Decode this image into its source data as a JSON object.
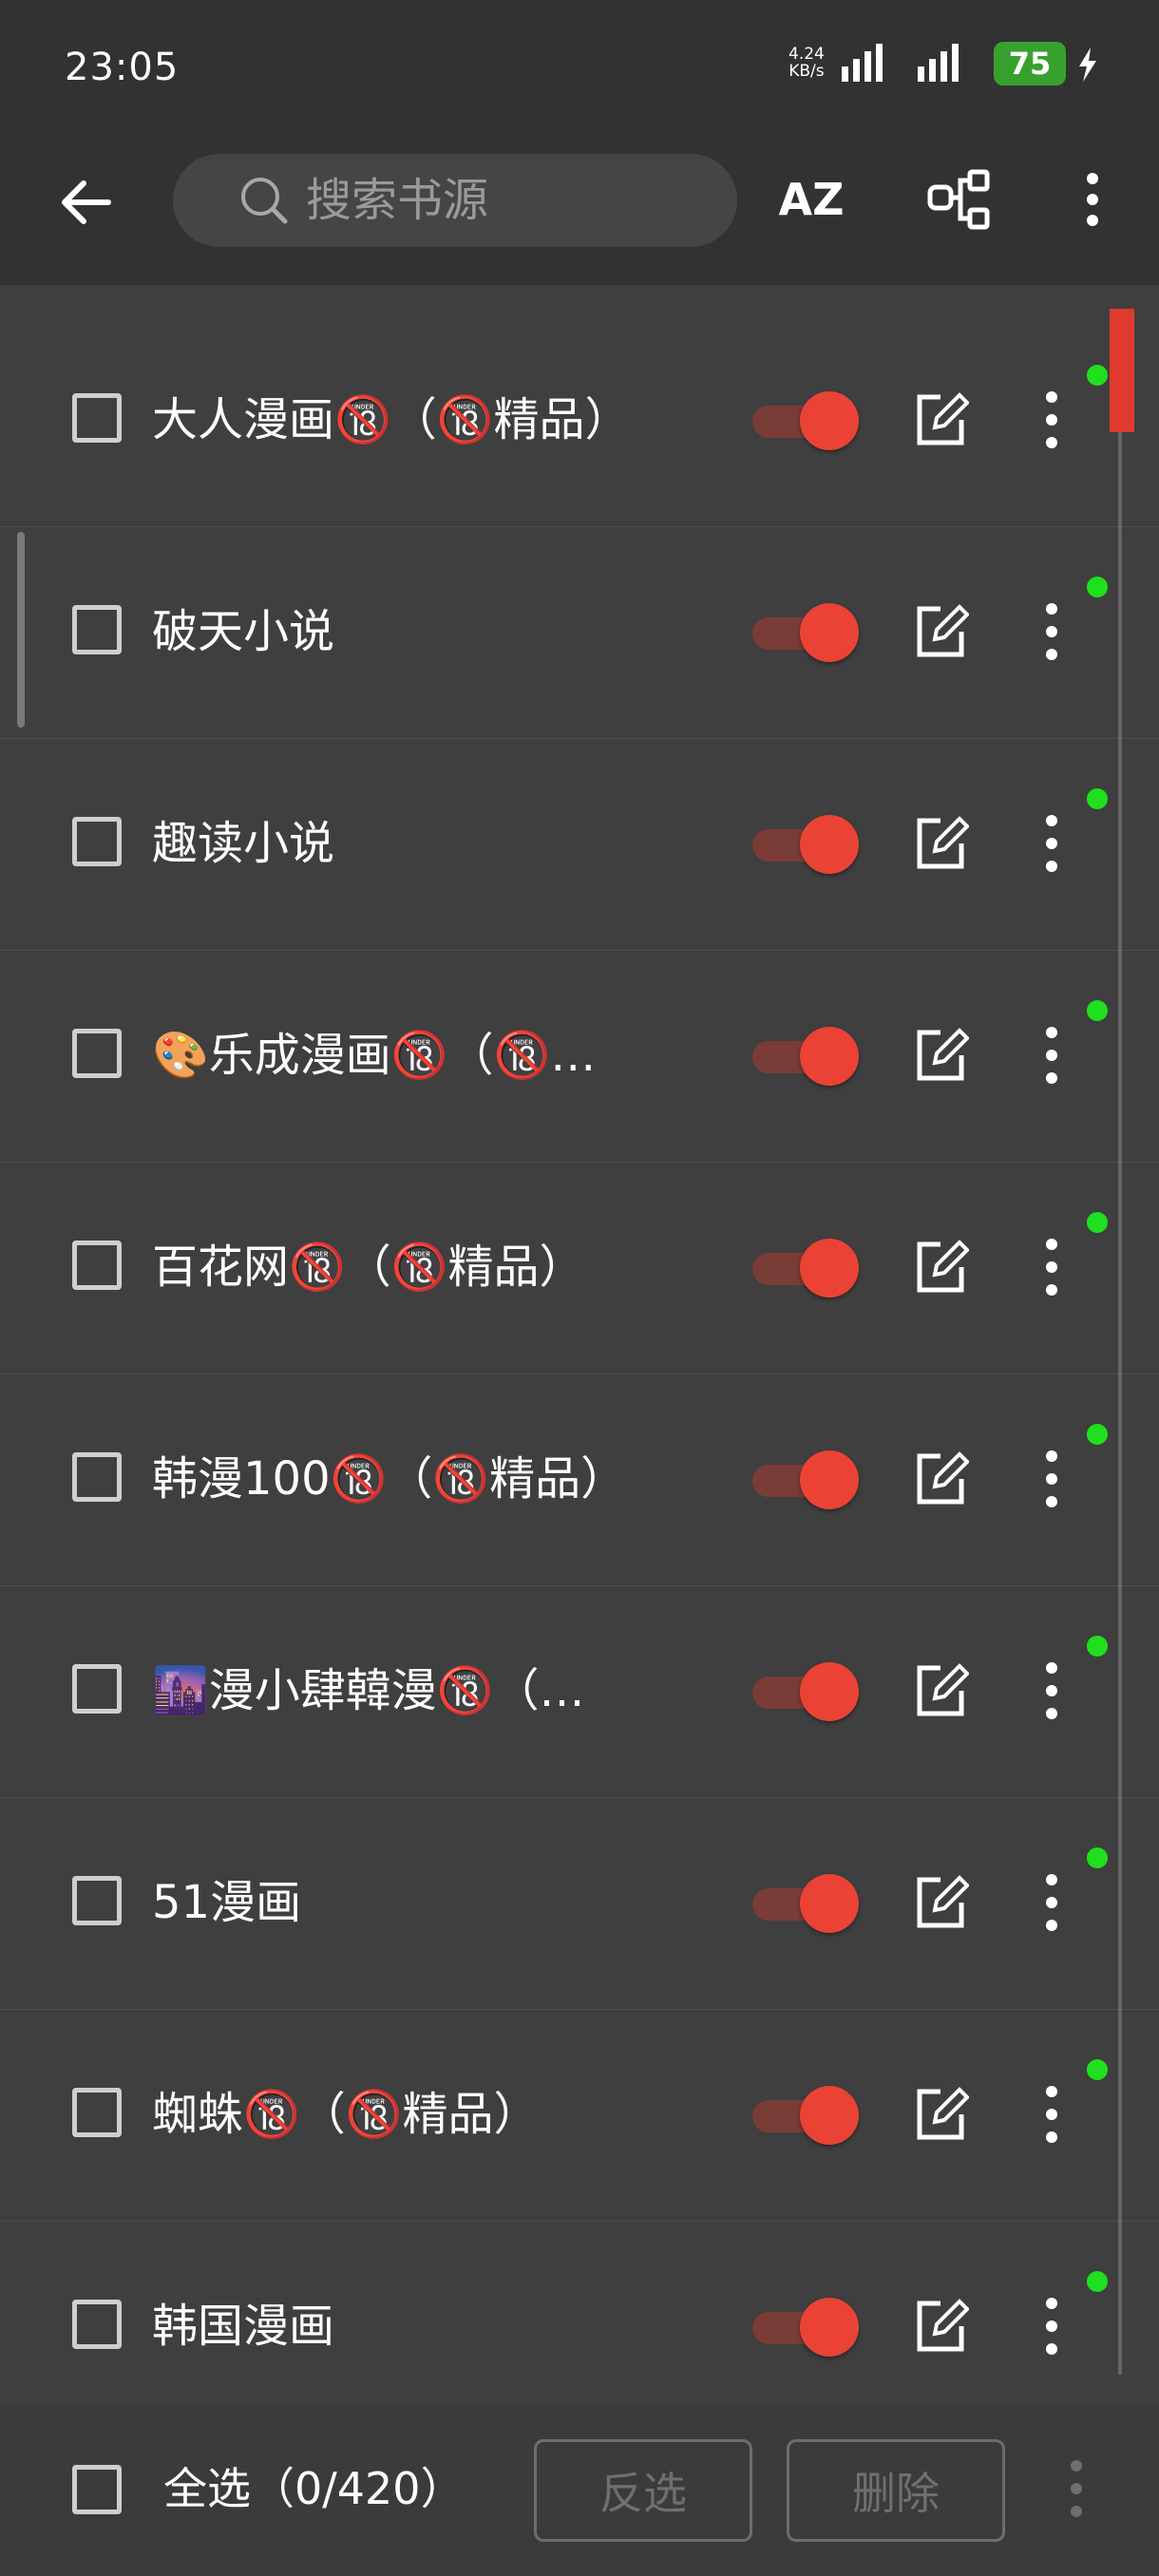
{
  "status_bar": {
    "time": "23:05",
    "net_speed": "4.24",
    "net_unit": "KB/s",
    "battery": "75"
  },
  "toolbar": {
    "search_placeholder": "搜索书源",
    "sort_label": "AZ"
  },
  "sources": [
    {
      "name": "大人漫画🔞（🔞精品）",
      "enabled": true
    },
    {
      "name": "破天小说",
      "enabled": true
    },
    {
      "name": "趣读小说",
      "enabled": true
    },
    {
      "name": "🎨乐成漫画🔞（🔞…",
      "enabled": true
    },
    {
      "name": "百花网🔞（🔞精品）",
      "enabled": true
    },
    {
      "name": "韩漫100🔞（🔞精品）",
      "enabled": true
    },
    {
      "name": "🌆漫小肆韓漫🔞（…",
      "enabled": true
    },
    {
      "name": "51漫画",
      "enabled": true
    },
    {
      "name": "蜘蛛🔞（🔞精品）",
      "enabled": true
    },
    {
      "name": "韩国漫画",
      "enabled": true
    }
  ],
  "bottom": {
    "select_all": "全选（0/420）",
    "invert": "反选",
    "delete": "删除"
  },
  "colors": {
    "accent": "#ea4335",
    "status_dot": "#1ee01e",
    "background": "#3f3f3f",
    "battery": "#38a12e"
  }
}
